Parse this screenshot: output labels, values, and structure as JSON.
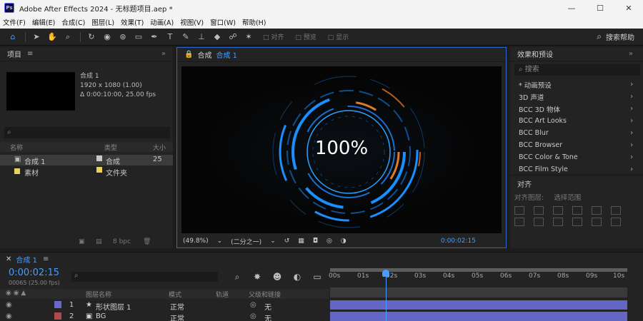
{
  "window": {
    "title": "Adobe After Effects 2024 - 无标题项目.aep *",
    "logo": "Ps",
    "controls": {
      "minimize": "—",
      "maximize": "☐",
      "close": "✕"
    }
  },
  "menu": [
    "文件(F)",
    "编辑(E)",
    "合成(C)",
    "图层(L)",
    "效果(T)",
    "动画(A)",
    "视图(V)",
    "窗口(W)",
    "帮助(H)"
  ],
  "toolbar": {
    "tools": [
      "home-icon",
      "arrow-icon",
      "hand-icon",
      "zoom-icon",
      "rotate-icon",
      "camera-icon",
      "pan-behind-icon",
      "rect-icon",
      "pen-icon",
      "text-icon",
      "brush-icon",
      "clone-icon",
      "eraser-icon",
      "roto-icon",
      "puppet-icon"
    ],
    "toggle1": "□ 对齐",
    "toggle2": "□ 预览",
    "toggle3": "□ 显示",
    "search_help": "搜索帮助"
  },
  "project": {
    "title": "项目",
    "comp_name": "合成 1",
    "comp_res": "1920 x 1080 (1.00)",
    "comp_dur": "Δ 0:00:10:00, 25.00 fps",
    "search_placeholder": "⌕",
    "col_name": "名称",
    "col_type": "类型",
    "col_size": "大小",
    "items": [
      {
        "name": "合成 1",
        "type": "合成",
        "extra": "25",
        "color": "#c8c8c8",
        "selected": true
      },
      {
        "name": "素材",
        "type": "文件夹",
        "extra": "",
        "color": "#e7d35a",
        "selected": false
      }
    ],
    "footer_bpc": "8 bpc"
  },
  "composition": {
    "tab_label": "合成",
    "tab_name": "合成 1",
    "progress_text": "100%",
    "zoom": "(49.8%)",
    "resolution": "(二分之一)",
    "timecode": "0:00:02:15"
  },
  "effects": {
    "title": "效果和预设",
    "search": "⌕ 搜索",
    "items": [
      "* 动画预设",
      "3D 声道",
      "BCC 3D 物体",
      "BCC Art Looks",
      "BCC Blur",
      "BCC Browser",
      "BCC Color & Tone",
      "BCC Film Style"
    ]
  },
  "align": {
    "title": "对齐",
    "align_to": "对齐图层:",
    "option": "选择范围"
  },
  "timeline": {
    "tab_name": "合成 1",
    "timecode": "0:00:02:15",
    "frames": "00065 (25.00 fps)",
    "search_placeholder": "⌕",
    "col_layer_name": "图层名称",
    "col_mode": "模式",
    "col_trkmat": "轨道",
    "col_parent": "父级和链接",
    "ruler_labels": [
      "00s",
      "01s",
      "02s",
      "03s",
      "04s",
      "05s",
      "06s",
      "07s",
      "08s",
      "09s",
      "10s"
    ],
    "layers": [
      {
        "num": "1",
        "name": "形状图层 1",
        "mode": "正常",
        "parent": "无",
        "color": "#6b66c9",
        "track_color": "#6366c4"
      },
      {
        "num": "2",
        "name": "BG",
        "mode": "正常",
        "parent": "无",
        "color": "#b04a4a",
        "track_color": "#6366c4"
      }
    ]
  },
  "colors": {
    "accent": "#4a9dff",
    "panel": "#232323",
    "background": "#1d1d1d",
    "ring_blue": "#1a8fff",
    "ring_orange": "#e07a2a"
  }
}
